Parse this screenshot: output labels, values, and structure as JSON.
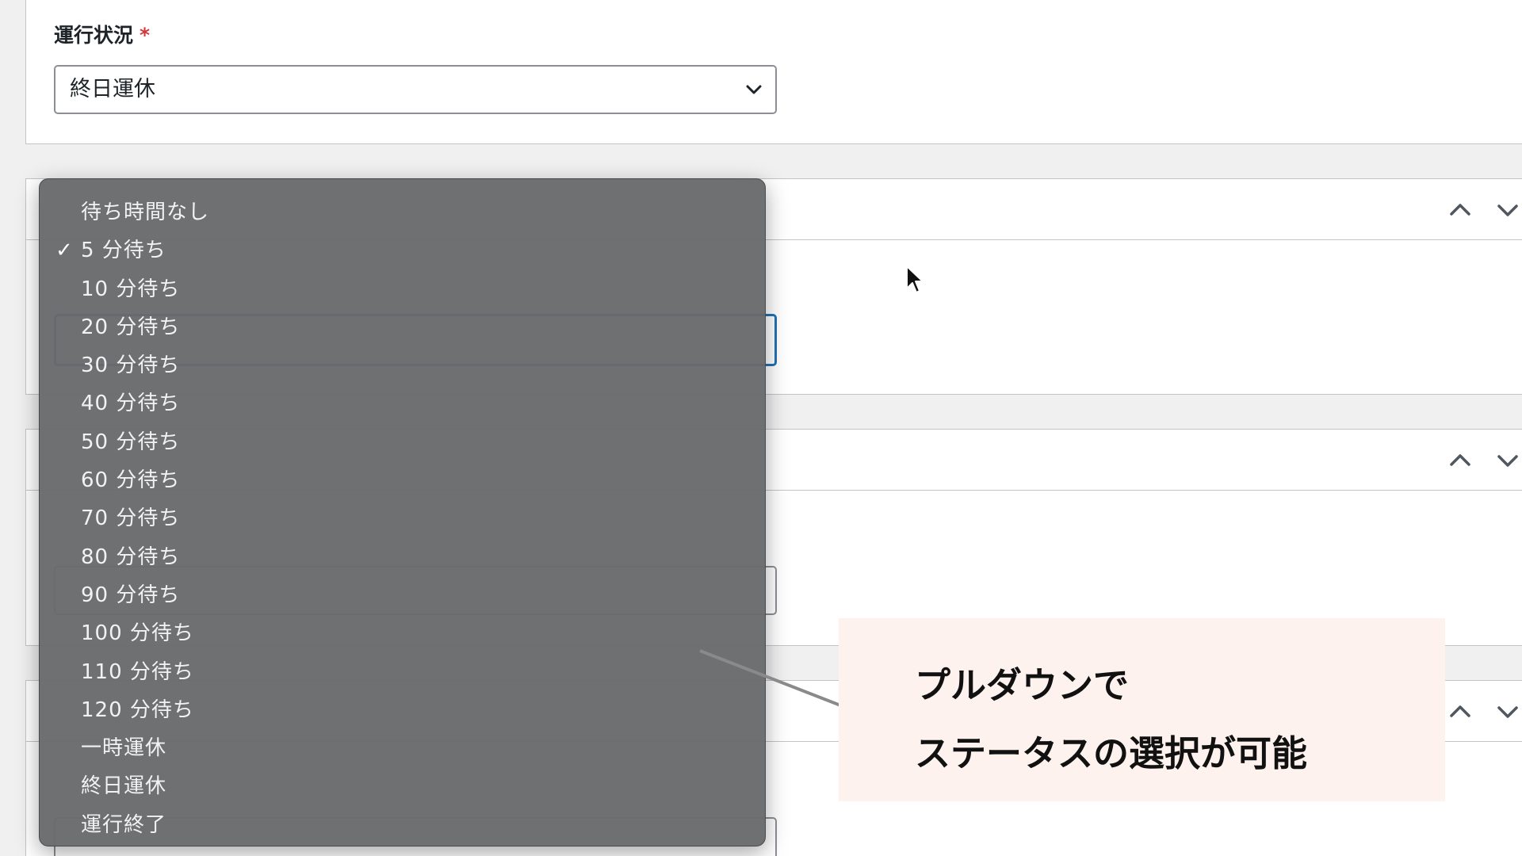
{
  "status_field": {
    "label": "運行状況",
    "required_mark": "*",
    "selected_value": "終日運休"
  },
  "wait_dropdown": {
    "selected_index": 1,
    "check_mark": "✓",
    "options": [
      "待ち時間なし",
      "5 分待ち",
      "10 分待ち",
      "20 分待ち",
      "30 分待ち",
      "40 分待ち",
      "50 分待ち",
      "60 分待ち",
      "70 分待ち",
      "80 分待ち",
      "90 分待ち",
      "100 分待ち",
      "110 分待ち",
      "120 分待ち",
      "一時運休",
      "終日運休",
      "運行終了"
    ]
  },
  "callout": {
    "line1": "プルダウンで",
    "line2": "ステータスの選択が可能"
  },
  "colors": {
    "focus_border": "#2271b1",
    "required": "#d63638",
    "dropdown_bg": "#69696c",
    "callout_bg": "#fdf2ed"
  },
  "icons": [
    "chevron-down-icon",
    "chevron-up-icon",
    "cursor-arrow-icon",
    "checkmark-icon"
  ]
}
